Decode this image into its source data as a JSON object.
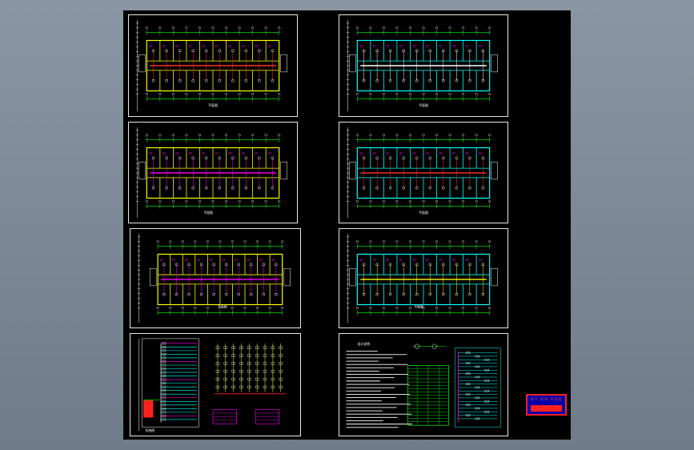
{
  "viewer": {
    "background_color": "#7d8996",
    "model_space_color": "#000000"
  },
  "sheets": [
    {
      "id": "floor-plan-1",
      "kind": "plan",
      "caption": "平面图",
      "accent": "#ffff00",
      "wire": "#ff3030"
    },
    {
      "id": "floor-plan-2",
      "kind": "plan",
      "caption": "平面图",
      "accent": "#00ffff",
      "wire": "#ffffff"
    },
    {
      "id": "floor-plan-3",
      "kind": "plan",
      "caption": "平面图",
      "accent": "#ffff00",
      "wire": "#ff00ff"
    },
    {
      "id": "floor-plan-4",
      "kind": "plan",
      "caption": "平面图",
      "accent": "#00ffff",
      "wire": "#ff3030"
    },
    {
      "id": "floor-plan-5",
      "kind": "plan",
      "caption": "平面图",
      "accent": "#ffff00",
      "wire": "#ff00ff"
    },
    {
      "id": "floor-plan-6",
      "kind": "plan",
      "caption": "平面图",
      "accent": "#00ffff",
      "wire": "#ffff00"
    },
    {
      "id": "system-diagram",
      "kind": "system",
      "caption": "系统图"
    },
    {
      "id": "design-notes",
      "kind": "notes",
      "caption": "设计说明"
    }
  ],
  "title_block": {
    "title": "电气 照明 平面图",
    "frame_color": "#ff2020",
    "fill_color": "#0000aa"
  }
}
